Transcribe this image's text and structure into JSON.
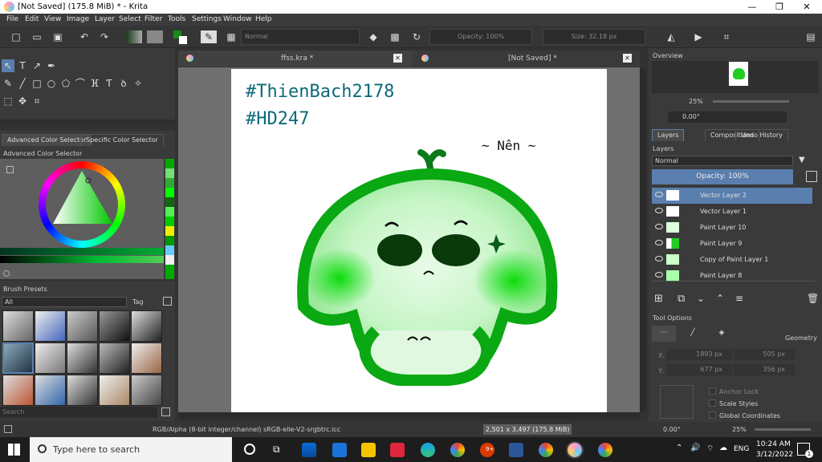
{
  "window": {
    "title": "[Not Saved]  (175.8 MiB)  * - Krita",
    "buttons": [
      "—",
      "❐",
      "✕"
    ]
  },
  "menu": [
    "File",
    "Edit",
    "View",
    "Image",
    "Layer",
    "Select",
    "Filter",
    "Tools",
    "Settings",
    "Window",
    "Help"
  ],
  "toolbar": {
    "blend_mode": "Normal",
    "opacity": "Opacity: 100%",
    "size": "Size: 32.18 px"
  },
  "color_dock": {
    "tabs": [
      "Advanced Color Selector",
      "Specific Color Selector"
    ],
    "title": "Advanced Color Selector"
  },
  "brush_dock": {
    "title": "Brush Presets",
    "filter": "All",
    "tag": "Tag",
    "search_placeholder": "Search"
  },
  "documents": {
    "tabs": [
      "ffss.kra *",
      "[Not Saved]  *"
    ]
  },
  "artwork": {
    "line1": "#ThienBach2178",
    "line2": "#HD247",
    "signature": "~ Nên ~"
  },
  "overview": {
    "title": "Overview",
    "zoom": "25%",
    "rotation": "0.00°"
  },
  "layers_dock": {
    "tabs": [
      "Layers",
      "Compositions",
      "Undo History"
    ],
    "title": "Layers",
    "blend_mode": "Normal",
    "opacity": "Opacity:  100%",
    "layers": [
      {
        "name": "Vector Layer 2",
        "selected": true
      },
      {
        "name": "Vector Layer 1",
        "selected": false
      },
      {
        "name": "Paint Layer 10",
        "selected": false
      },
      {
        "name": "Paint Layer 9",
        "selected": false
      },
      {
        "name": "Copy of Paint Layer 1",
        "selected": false
      },
      {
        "name": "Paint Layer 8",
        "selected": false
      }
    ]
  },
  "tool_options": {
    "title": "Tool Options",
    "geometry": "Geometry",
    "x_label": "X:",
    "x_value": "1893 px",
    "x2_value": "505 px",
    "y_label": "Y:",
    "y_value": "677 px",
    "y2_value": "356 px",
    "anchor_lock": "Anchor Lock",
    "scale_styles": "Scale Styles",
    "global_coords": "Global Coordinates"
  },
  "status": {
    "color_model": "RGB/Alpha (8-bit integer/channel)  sRGB-elle-V2-srgbtrc.icc",
    "dimensions": "2,501 x 3,497 (175.8 MiB)",
    "rotation": "0.00°",
    "zoom": "25%"
  },
  "taskbar": {
    "search_placeholder": "Type here to search",
    "language": "ENG",
    "time": "10:24 AM",
    "date": "3/12/2022",
    "badge": "9+",
    "notification_count": "1"
  },
  "colors": {
    "accent": "#5a7fae",
    "green": "#0bbf0b"
  }
}
